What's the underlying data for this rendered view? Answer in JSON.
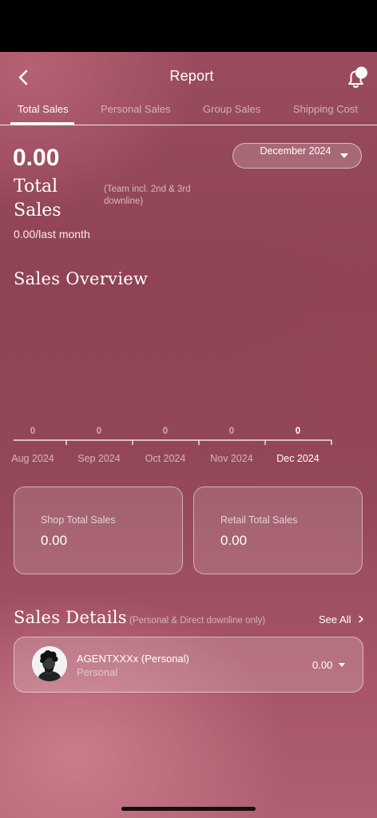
{
  "header": {
    "title": "Report"
  },
  "tabs": [
    {
      "label": "Total Sales",
      "active": true
    },
    {
      "label": "Personal Sales",
      "active": false
    },
    {
      "label": "Group Sales",
      "active": false
    },
    {
      "label": "Shipping Cost",
      "active": false
    }
  ],
  "summary": {
    "total_value": "0.00",
    "total_label": "Total Sales",
    "team_note": "(Team incl. 2nd & 3rd downline)",
    "last_month": "0.00/last month",
    "month_selector": "December 2024"
  },
  "overview": {
    "title": "Sales Overview"
  },
  "chart_data": {
    "type": "bar",
    "categories": [
      "Aug 2024",
      "Sep 2024",
      "Oct 2024",
      "Nov 2024",
      "Dec 2024"
    ],
    "values": [
      0,
      0,
      0,
      0,
      0
    ],
    "selected_category": "Dec 2024",
    "grid": false
  },
  "cards": [
    {
      "label": "Shop Total Sales",
      "value": "0.00"
    },
    {
      "label": "Retail Total Sales",
      "value": "0.00"
    }
  ],
  "details": {
    "title": "Sales Details",
    "note": "(Personal & Direct downline only)",
    "see_all": "See All",
    "rows": [
      {
        "name": "AGENTXXXx (Personal)",
        "type": "Personal",
        "amount": "0.00"
      }
    ]
  },
  "icons": {
    "back": "chevron-left-icon",
    "bell": "bell-icon",
    "dropdown": "caret-down-icon",
    "see_all": "chevron-right-icon",
    "avatar": "user-photo"
  },
  "colors": {
    "background": "#8f4354",
    "background_light": "#b06070",
    "text": "#ffffff"
  }
}
